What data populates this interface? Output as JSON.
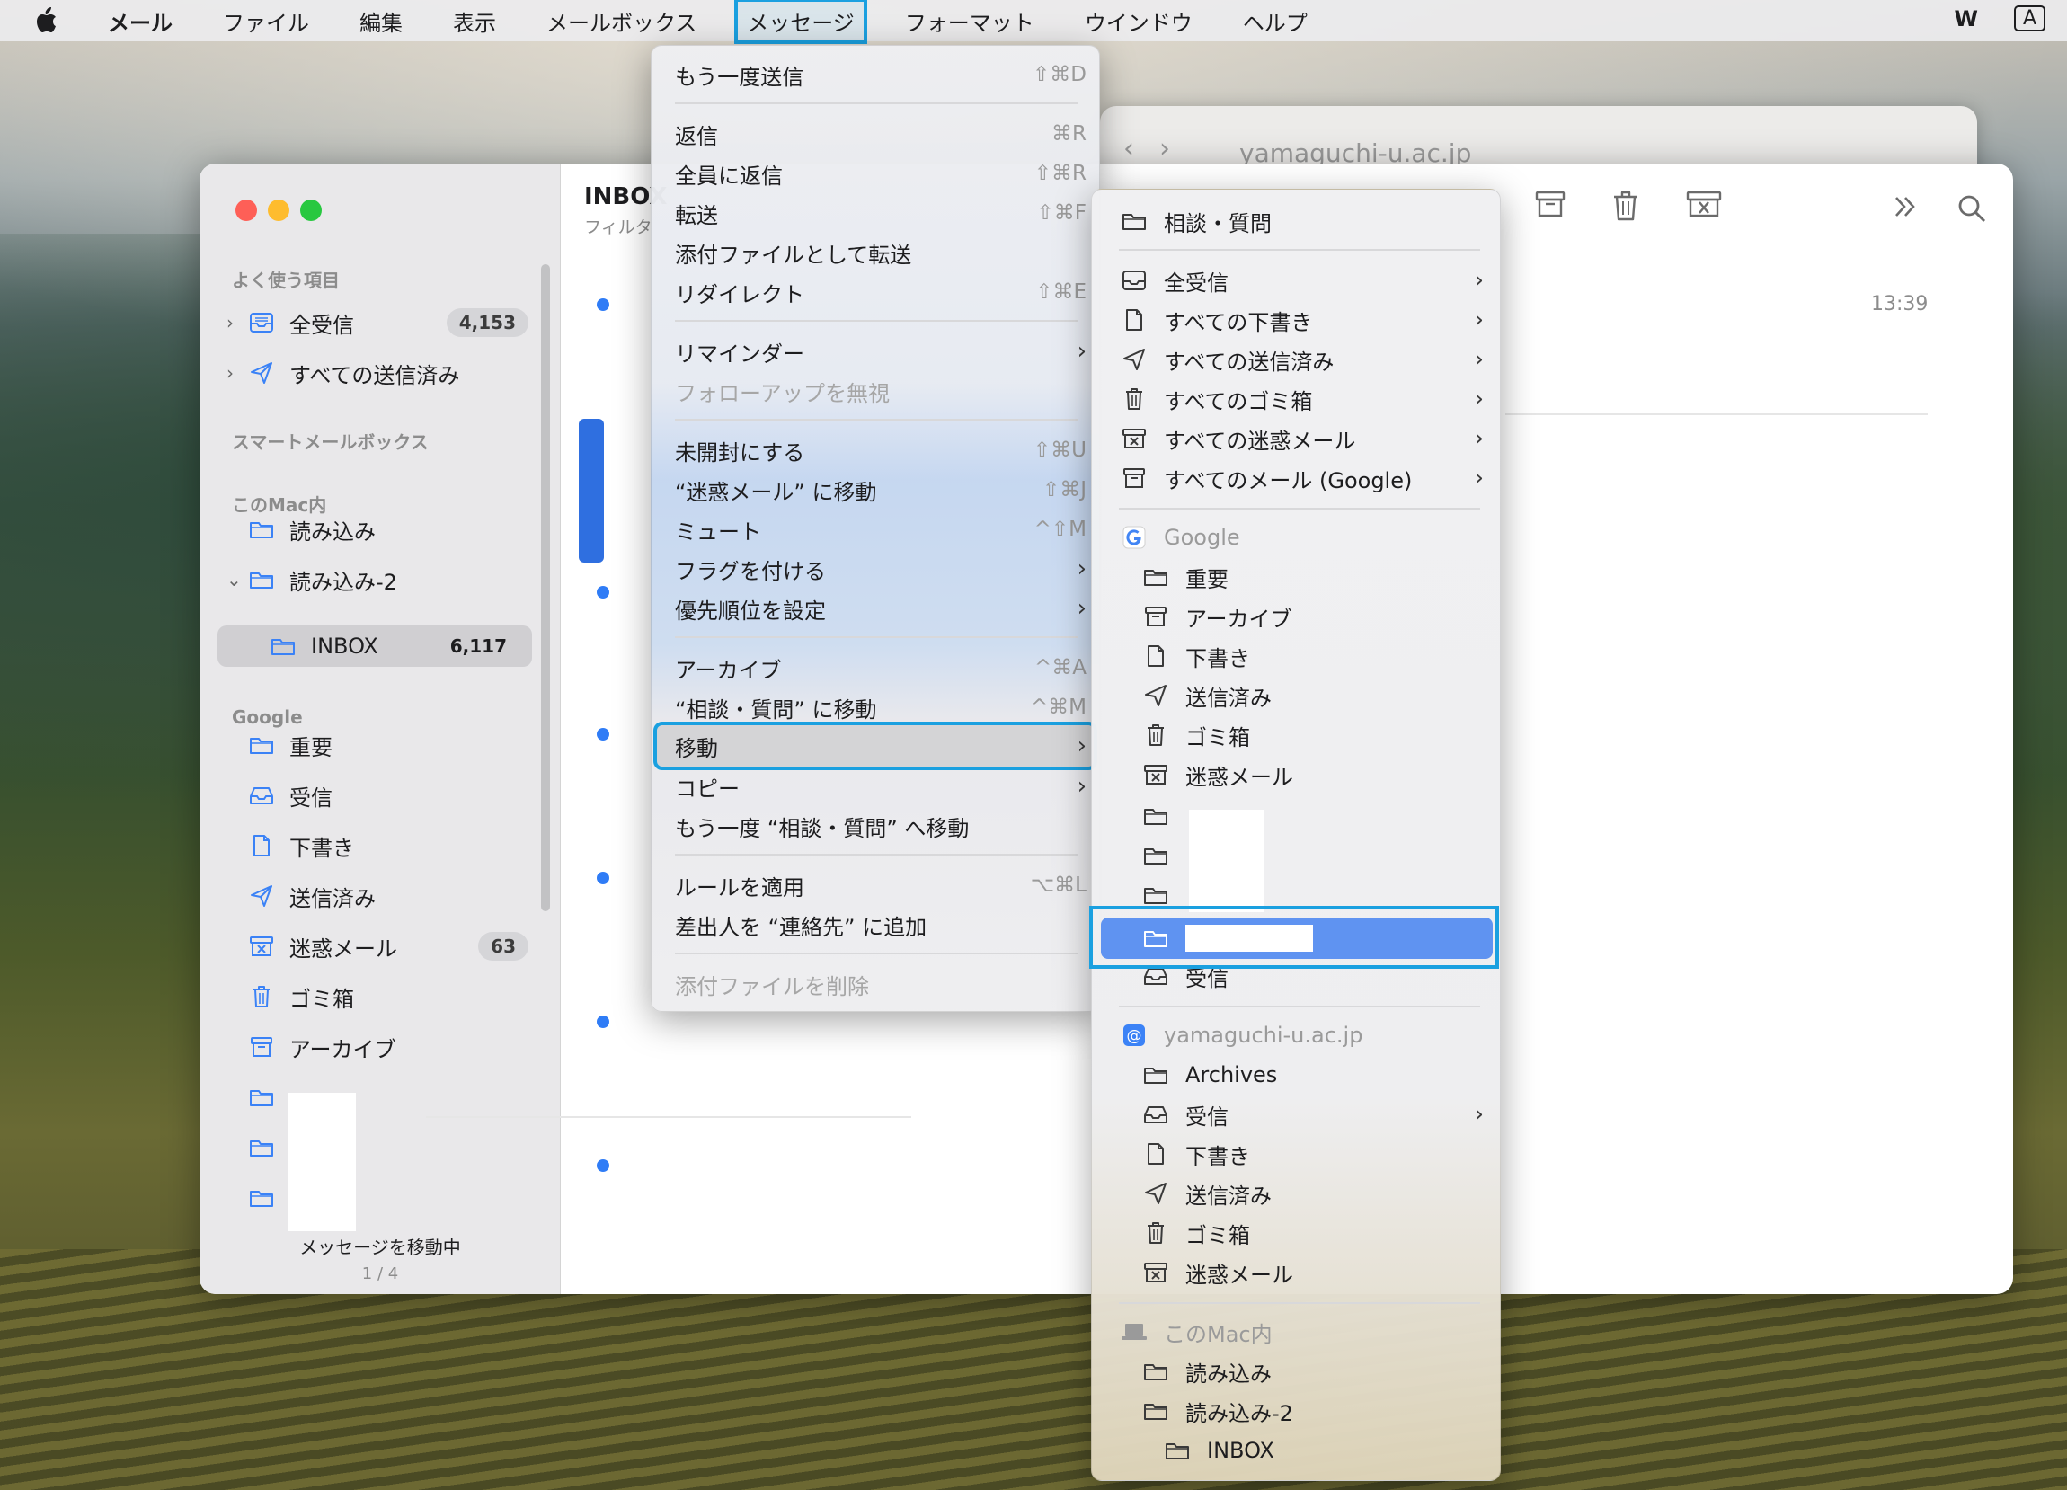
{
  "menubar": {
    "app_name": "メール",
    "items": [
      "ファイル",
      "編集",
      "表示",
      "メールボックス",
      "メッセージ",
      "フォーマット",
      "ウインドウ",
      "ヘルプ"
    ],
    "right_glyph": "W",
    "input_indicator": "A"
  },
  "back_window": {
    "domain": "yamaguchi-u.ac.jp"
  },
  "sidebar": {
    "favorites_header": "よく使う項目",
    "favorites": [
      {
        "label": "全受信",
        "count": "4,153"
      },
      {
        "label": "すべての送信済み"
      }
    ],
    "smart_header": "スマートメールボックス",
    "onmac_header": "このMac内",
    "onmac": [
      {
        "label": "読み込み"
      },
      {
        "label": "読み込み-2"
      },
      {
        "label": "INBOX",
        "count": "6,117"
      }
    ],
    "google_header": "Google",
    "google": [
      {
        "label": "重要"
      },
      {
        "label": "受信"
      },
      {
        "label": "下書き"
      },
      {
        "label": "送信済み"
      },
      {
        "label": "迷惑メール",
        "count": "63"
      },
      {
        "label": "ゴミ箱"
      },
      {
        "label": "アーカイブ"
      }
    ],
    "status": {
      "title": "メッセージを移動中",
      "progress": "1 / 4"
    }
  },
  "list": {
    "title": "INBOX",
    "subtitle": "フィルタ"
  },
  "reading": {
    "time": "13:39"
  },
  "message_menu": {
    "items": [
      {
        "label": "もう一度送信",
        "shortcut": "⇧⌘D"
      },
      {
        "label": "返信",
        "shortcut": "⌘R"
      },
      {
        "label": "全員に返信",
        "shortcut": "⇧⌘R"
      },
      {
        "label": "転送",
        "shortcut": "⇧⌘F"
      },
      {
        "label": "添付ファイルとして転送",
        "shortcut": ""
      },
      {
        "label": "リダイレクト",
        "shortcut": "⇧⌘E"
      },
      {
        "label": "リマインダー",
        "shortcut": ""
      },
      {
        "label": "フォローアップを無視",
        "shortcut": ""
      },
      {
        "label": "未開封にする",
        "shortcut": "⇧⌘U"
      },
      {
        "label": "“迷惑メール” に移動",
        "shortcut": "⇧⌘J"
      },
      {
        "label": "ミュート",
        "shortcut": "^⇧M"
      },
      {
        "label": "フラグを付ける",
        "shortcut": ""
      },
      {
        "label": "優先順位を設定",
        "shortcut": ""
      },
      {
        "label": "アーカイブ",
        "shortcut": "^⌘A"
      },
      {
        "label": "“相談・質問” に移動",
        "shortcut": "^⌘M"
      },
      {
        "label": "移動",
        "shortcut": ""
      },
      {
        "label": "コピー",
        "shortcut": ""
      },
      {
        "label": "もう一度 “相談・質問” へ移動",
        "shortcut": ""
      },
      {
        "label": "ルールを適用",
        "shortcut": "⌥⌘L"
      },
      {
        "label": "差出人を “連絡先” に追加",
        "shortcut": ""
      },
      {
        "label": "添付ファイルを削除",
        "shortcut": ""
      }
    ]
  },
  "move_submenu": {
    "recent": "相談・質問",
    "all": [
      "全受信",
      "すべての下書き",
      "すべての送信済み",
      "すべてのゴミ箱",
      "すべての迷惑メール",
      "すべてのメール (Google)"
    ],
    "google_header": "Google",
    "google": [
      "重要",
      "アーカイブ",
      "下書き",
      "送信済み",
      "ゴミ箱",
      "迷惑メール",
      "受信"
    ],
    "yamaguchi_header": "yamaguchi-u.ac.jp",
    "yamaguchi": [
      "Archives",
      "受信",
      "下書き",
      "送信済み",
      "ゴミ箱",
      "迷惑メール"
    ],
    "onmac_header": "このMac内",
    "onmac": [
      "読み込み",
      "読み込み-2",
      "INBOX"
    ]
  }
}
